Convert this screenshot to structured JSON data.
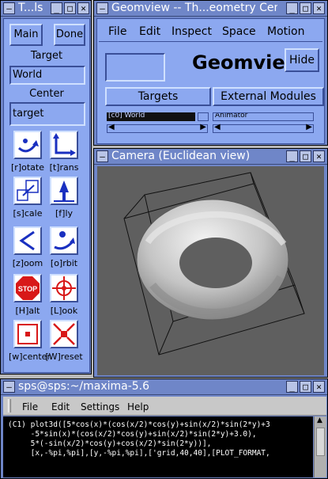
{
  "tools_window": {
    "title": "T...ls",
    "main_label": "Main",
    "done_label": "Done",
    "target_label": "Target",
    "target_value": "World",
    "center_label": "Center",
    "center_value": "target",
    "tools": [
      {
        "caption": "[r]otate",
        "icon": "rotate-icon"
      },
      {
        "caption": "[t]rans",
        "icon": "translate-icon"
      },
      {
        "caption": "[s]cale",
        "icon": "scale-icon"
      },
      {
        "caption": "[f]ly",
        "icon": "fly-icon"
      },
      {
        "caption": "[z]oom",
        "icon": "zoom-icon"
      },
      {
        "caption": "[o]rbit",
        "icon": "orbit-icon"
      },
      {
        "caption": "[H]alt",
        "icon": "stop-icon",
        "sign": "STOP"
      },
      {
        "caption": "[L]ook",
        "icon": "look-icon"
      },
      {
        "caption": "[w]center",
        "icon": "center-icon"
      },
      {
        "caption": "[W]reset",
        "icon": "reset-icon"
      }
    ]
  },
  "geomview_window": {
    "title": "Geomview -- Th...eometry Center",
    "menu": [
      "File",
      "Edit",
      "Inspect",
      "Space",
      "Motion"
    ],
    "brand": "Geomview",
    "hide_label": "Hide",
    "tabs": [
      "Targets",
      "External Modules"
    ],
    "list_selected": "[c0] World",
    "list_right": "Animator"
  },
  "camera_window": {
    "title": "Camera (Euclidean view)"
  },
  "terminal_window": {
    "title": "sps@sps:~/maxima-5.6",
    "menu": [
      "File",
      "Edit",
      "Settings",
      "Help"
    ],
    "lines": [
      "(C1) plot3d([5*cos(x)*(cos(x/2)*cos(y)+sin(x/2)*sin(2*y)+3",
      "     -5*sin(x)*(cos(x/2)*cos(y)+sin(x/2)*sin(2*y)+3.0),",
      "     5*(-sin(x/2)*cos(y)+cos(x/2)*sin(2*y))],",
      "     [x,-%pi,%pi],[y,-%pi,%pi],['grid,40,40],[PLOT_FORMAT,"
    ]
  },
  "colors": {
    "title_bar": "#6f86c8",
    "panel_blue": "#8ca8f0",
    "camera_bg": "#5f5f5f",
    "terminal_bg": "#000000"
  }
}
